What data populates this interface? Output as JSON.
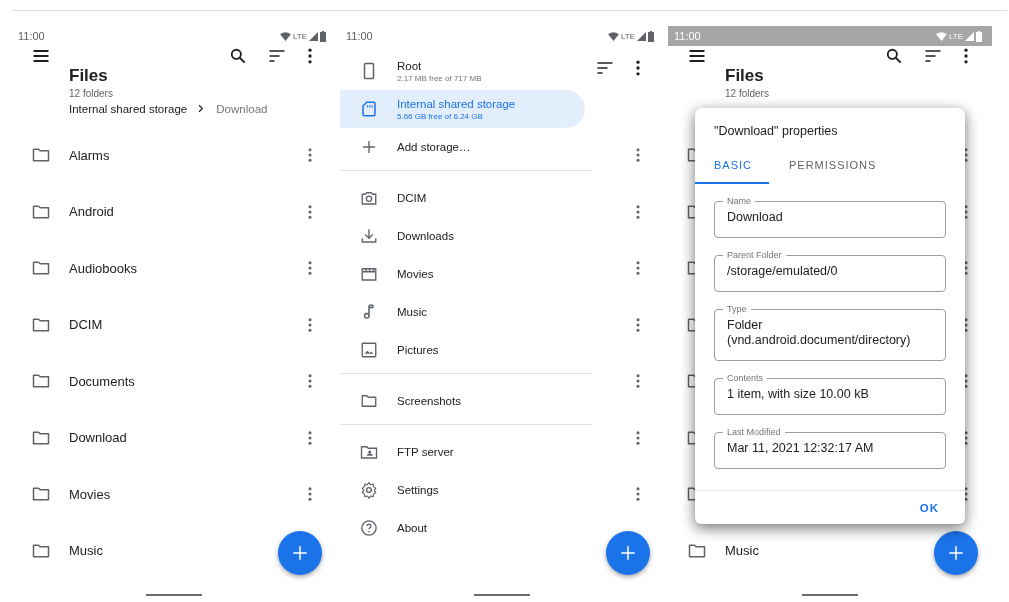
{
  "screens": [
    {
      "kind": "files",
      "status": {
        "time": "11:00",
        "network": "LTE",
        "light": false
      },
      "header": {
        "title": "Files",
        "subtitle": "12 folders",
        "actions": [
          {
            "kind": "menu"
          },
          {
            "kind": "search"
          },
          {
            "kind": "sort"
          },
          {
            "kind": "more"
          }
        ]
      },
      "breadcrumb": [
        {
          "label": "Internal shared storage",
          "current": false
        },
        {
          "label": "Download",
          "current": true
        }
      ],
      "rows": [
        {
          "kind": "folder",
          "label": "Alarms",
          "menu": true
        },
        {
          "kind": "folder",
          "label": "Android",
          "menu": true
        },
        {
          "kind": "folder",
          "label": "Audiobooks",
          "menu": true
        },
        {
          "kind": "folder",
          "label": "DCIM",
          "menu": true
        },
        {
          "kind": "folder",
          "label": "Documents",
          "menu": true
        },
        {
          "kind": "folder",
          "label": "Download",
          "menu": true
        },
        {
          "kind": "folder",
          "label": "Movies",
          "menu": true
        },
        {
          "kind": "folder",
          "label": "Music"
        }
      ]
    },
    {
      "kind": "drawer",
      "status": {
        "network": "LTE",
        "light": false
      },
      "header": {
        "actions": [
          {
            "kind": "sort"
          },
          {
            "kind": "more"
          }
        ]
      },
      "rows": [
        {
          "kind": "kebab_only",
          "menu": true
        },
        {
          "kind": "kebab_only",
          "menu": true
        },
        {
          "kind": "kebab_only",
          "menu": true
        },
        {
          "kind": "kebab_only",
          "menu": true
        },
        {
          "kind": "kebab_only",
          "menu": true
        },
        {
          "kind": "kebab_only",
          "menu": true
        },
        {
          "kind": "kebab_only",
          "menu": true
        }
      ],
      "drawer": {
        "time": "11:00",
        "sections": [
          [
            {
              "kind": "phone",
              "label": "Root",
              "detail": "2.17 MB free of 717 MB",
              "selected": false
            },
            {
              "kind": "sd",
              "label": "Internal shared storage",
              "detail": "5.66 GB free of 6.24 GB",
              "selected": true
            },
            {
              "kind": "plus",
              "label": "Add storage…",
              "selected": false
            }
          ],
          [
            {
              "kind": "camera",
              "label": "DCIM",
              "selected": false
            },
            {
              "kind": "download",
              "label": "Downloads",
              "selected": false
            },
            {
              "kind": "movie",
              "label": "Movies",
              "selected": false
            },
            {
              "kind": "music",
              "label": "Music",
              "selected": false
            },
            {
              "kind": "image",
              "label": "Pictures",
              "selected": false
            }
          ],
          [
            {
              "kind": "folder",
              "label": "Screenshots",
              "selected": false
            }
          ],
          [
            {
              "kind": "ftp",
              "label": "FTP server",
              "selected": false
            },
            {
              "kind": "gear",
              "label": "Settings",
              "selected": false
            },
            {
              "kind": "help",
              "label": "About",
              "selected": false
            }
          ]
        ]
      }
    },
    {
      "kind": "dialog",
      "status": {
        "time": "11:00",
        "network": "LTE",
        "light": true
      },
      "header": {
        "title": "Files",
        "subtitle": "12 folders",
        "actions": [
          {
            "kind": "menu"
          },
          {
            "kind": "search"
          },
          {
            "kind": "sort"
          },
          {
            "kind": "more"
          }
        ]
      },
      "rows": [
        {
          "kind": "icon_only",
          "menu": true
        },
        {
          "kind": "icon_only",
          "menu": true
        },
        {
          "kind": "icon_only",
          "menu": true
        },
        {
          "kind": "icon_only",
          "menu": true
        },
        {
          "kind": "icon_only",
          "menu": true
        },
        {
          "kind": "icon_only",
          "menu": true
        },
        {
          "kind": "icon_only",
          "menu": true
        },
        {
          "kind": "folder",
          "label": "Music"
        }
      ],
      "dialog": {
        "title": "\"Download\" properties",
        "tabs": [
          {
            "label": "BASIC",
            "selected": true
          },
          {
            "label": "PERMISSIONS",
            "selected": false
          }
        ],
        "fields": [
          {
            "label": "Name",
            "value": "Download"
          },
          {
            "label": "Parent Folder",
            "value": "/storage/emulated/0"
          },
          {
            "label": "Type",
            "value": "Folder (vnd.android.document/directory)"
          },
          {
            "label": "Contents",
            "value": "1 item, with size 10.00 kB"
          },
          {
            "label": "Last Modified",
            "value": "Mar 11, 2021 12:32:17 AM"
          }
        ],
        "buttons": [
          "OK"
        ]
      }
    }
  ]
}
